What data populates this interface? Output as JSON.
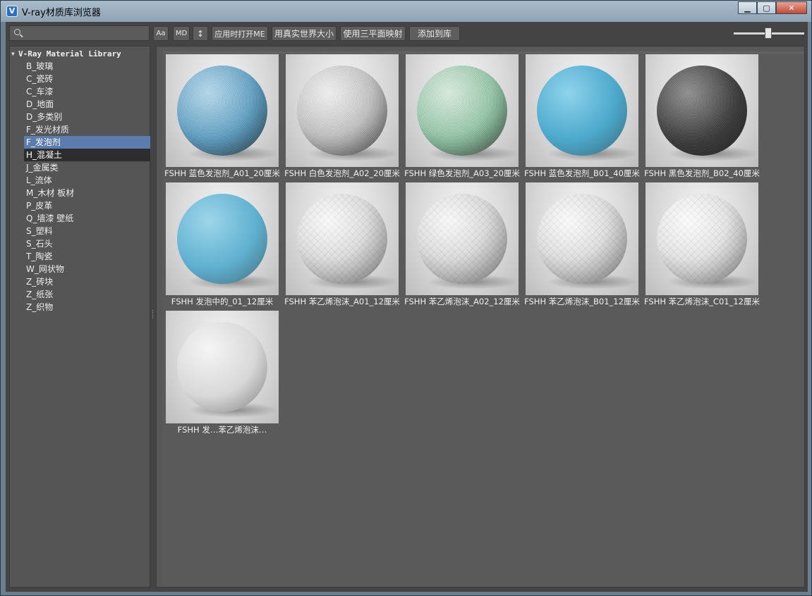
{
  "window": {
    "title": "V-ray材质库浏览器",
    "app_icon_letter": "V",
    "min_glyph": "▁",
    "max_glyph": "▢",
    "close_glyph": "✕"
  },
  "toolbar": {
    "search_placeholder": "",
    "btn_case": "Aa",
    "btn_md": "MD",
    "btn_sort": "↕",
    "btn_open_me": "应用时打开ME",
    "btn_real_world": "用真实世界大小",
    "btn_triplanar": "使用三平面映射",
    "btn_add_library": "添加到库",
    "zoom_level": 0.49
  },
  "tree": {
    "root_arrow": "▼",
    "root_label": "V-Ray Material Library",
    "items": [
      {
        "label": "B_玻璃",
        "state": ""
      },
      {
        "label": "C_瓷砖",
        "state": ""
      },
      {
        "label": "C_车漆",
        "state": ""
      },
      {
        "label": "D_地面",
        "state": ""
      },
      {
        "label": "D_多类别",
        "state": ""
      },
      {
        "label": "F_发光材质",
        "state": ""
      },
      {
        "label": "F_发泡剂",
        "state": "selected"
      },
      {
        "label": "H_混凝土",
        "state": "hover"
      },
      {
        "label": "J_金属类",
        "state": ""
      },
      {
        "label": "L_流体",
        "state": ""
      },
      {
        "label": "M_木材 板材",
        "state": ""
      },
      {
        "label": "P_皮革",
        "state": ""
      },
      {
        "label": "Q_墙漆 壁纸",
        "state": ""
      },
      {
        "label": "S_塑料",
        "state": ""
      },
      {
        "label": "S_石头",
        "state": ""
      },
      {
        "label": "T_陶瓷",
        "state": ""
      },
      {
        "label": "W_网状物",
        "state": ""
      },
      {
        "label": "Z_砖块",
        "state": ""
      },
      {
        "label": "Z_纸张",
        "state": ""
      },
      {
        "label": "Z_织物",
        "state": ""
      }
    ]
  },
  "materials": [
    {
      "name": "FSHH 蓝色发泡剂_A01_20厘米",
      "color": "#5a9ec4",
      "highlight": "#9fd0ea",
      "texture": "speckle"
    },
    {
      "name": "FSHH 白色发泡剂_A02_20厘米",
      "color": "#bdbdbd",
      "highlight": "#f2f2f2",
      "texture": "speckle"
    },
    {
      "name": "FSHH 绿色发泡剂_A03_20厘米",
      "color": "#8fc6a5",
      "highlight": "#cfead8",
      "texture": "speckle"
    },
    {
      "name": "FSHH 蓝色发泡剂_B01_40厘米",
      "color": "#4ca9cc",
      "highlight": "#8fd3ec",
      "texture": "smooth"
    },
    {
      "name": "FSHH 黑色发泡剂_B02_40厘米",
      "color": "#3a3a3a",
      "highlight": "#6a6a6a",
      "texture": "speckle"
    },
    {
      "name": "FSHH 发泡中的_01_12厘米",
      "color": "#5fb0d0",
      "highlight": "#9ed6ea",
      "texture": "smooth"
    },
    {
      "name": "FSHH 苯乙烯泡沫_A01_12厘米",
      "color": "#d4d4d4",
      "highlight": "#f5f5f5",
      "texture": "cells"
    },
    {
      "name": "FSHH 苯乙烯泡沫_A02_12厘米",
      "color": "#d2d2d2",
      "highlight": "#f4f4f4",
      "texture": "cells"
    },
    {
      "name": "FSHH 苯乙烯泡沫_B01_12厘米",
      "color": "#d6d6d6",
      "highlight": "#f6f6f6",
      "texture": "cells"
    },
    {
      "name": "FSHH 苯乙烯泡沫_C01_12厘米",
      "color": "#dcdcdc",
      "highlight": "#f8f8f8",
      "texture": "cells"
    },
    {
      "name": "FSHH 发…苯乙烯泡沫…",
      "color": "#d8d8d8",
      "highlight": "#f5f5f5",
      "texture": "smooth"
    }
  ]
}
